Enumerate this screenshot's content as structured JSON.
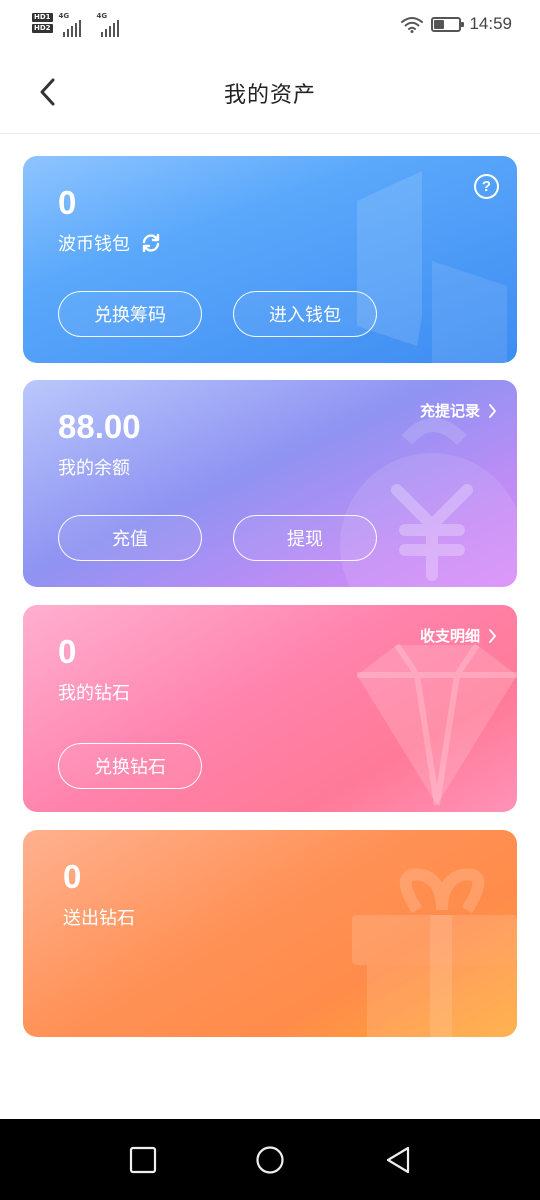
{
  "status_bar": {
    "hd1": "HD1",
    "hd2": "HD2",
    "net1": "4G",
    "net2": "4G",
    "battery_level": 0.4,
    "time": "14:59"
  },
  "header": {
    "title": "我的资产",
    "back_icon": "chevron-left-icon"
  },
  "cards": {
    "wallet": {
      "amount": "0",
      "label": "波币钱包",
      "refresh_icon": "refresh-icon",
      "help_icon": "help-icon",
      "help_text": "?",
      "buttons": [
        "兑换筹码",
        "进入钱包"
      ],
      "color_from": "#8fc4ff",
      "color_to": "#3d8cf2"
    },
    "balance": {
      "amount": "88.00",
      "label": "我的余额",
      "link": "充提记录",
      "buttons": [
        "充值",
        "提现"
      ],
      "color_from": "#b9c8fb",
      "color_to": "#da8df9"
    },
    "diamond": {
      "amount": "0",
      "label": "我的钻石",
      "link": "收支明细",
      "buttons": [
        "兑换钻石"
      ],
      "color_from": "#ffb0d0",
      "color_to": "#ff7a97"
    },
    "sent": {
      "amount": "0",
      "label": "送出钻石",
      "color_from": "#ffb190",
      "color_to": "#ffa836"
    }
  },
  "navbar": {
    "recent_icon": "square-icon",
    "home_icon": "circle-icon",
    "back_icon": "triangle-back-icon"
  }
}
